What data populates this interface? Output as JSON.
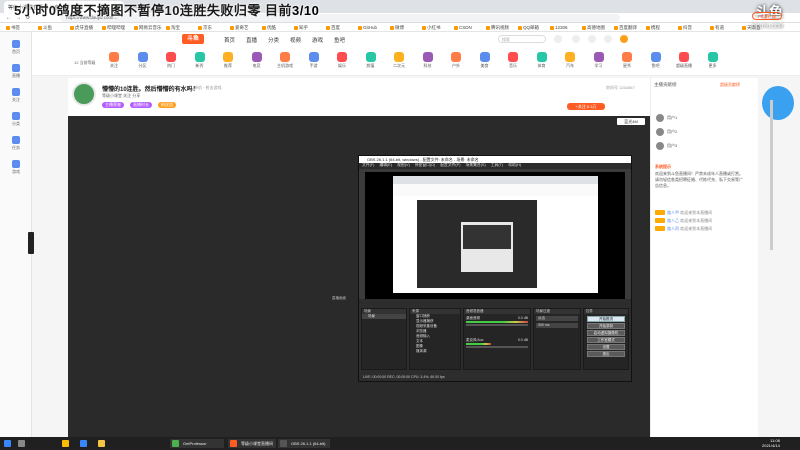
{
  "browser": {
    "tabs": [
      {
        "label": "等级小课堂直播间·斗鱼",
        "active": true
      },
      {
        "label": "……",
        "active": false
      }
    ],
    "url": "https://www.douyu.com/...",
    "bookmarks": [
      "书签",
      "斗鱼",
      "虎牙直播",
      "哔哩哔哩",
      "网易云音乐",
      "淘宝",
      "京东",
      "爱奇艺",
      "优酷",
      "知乎",
      "百度",
      "GitHub",
      "微博",
      "小红书",
      "CSDN",
      "腾讯视频",
      "QQ邮箱",
      "12306",
      "高德地图",
      "百度翻译",
      "携程",
      "抖音",
      "有道",
      "天眼查"
    ]
  },
  "overlay_title": {
    "text": "5小时0鸽度不摘图不暂停10连胜失败归零  目前",
    "progress": "3/10"
  },
  "logo_overlay": {
    "text": "斗鱼",
    "sub": "DOUYU.COM"
  },
  "left_sidebar": [
    {
      "label": "首页",
      "icon": "home-icon"
    },
    {
      "label": "直播",
      "icon": "live-icon"
    },
    {
      "label": "关注",
      "icon": "heart-icon"
    },
    {
      "label": "分类",
      "icon": "grid-icon"
    },
    {
      "label": "任务",
      "icon": "task-icon"
    },
    {
      "label": "游戏",
      "icon": "game-icon"
    }
  ],
  "site_header": {
    "logo": "斗鱼",
    "nav": [
      "首页",
      "直播",
      "分类",
      "视频",
      "游戏",
      "鱼吧"
    ],
    "search_placeholder": "搜索"
  },
  "categories": [
    "关注",
    "分区",
    "热门",
    "新秀",
    "推荐",
    "电竞",
    "主机游戏",
    "手游",
    "娱乐",
    "颜值",
    "二次元",
    "科技",
    "户外",
    "美食",
    "音乐",
    "体育",
    "汽车",
    "学习",
    "星秀",
    "鱼吧",
    "超级直播",
    "更多",
    "PC客户端"
  ],
  "pc_button": "PC客户端",
  "level_box": "12 当前等级",
  "room": {
    "title": "懵懵的10连胜。然后懵懵的有水吗！",
    "category": "单机 · 射击游戏",
    "anchor": "等级小课堂  关注  分享",
    "badges": [
      {
        "label": "主播荣誉",
        "color": "#b35cff"
      },
      {
        "label": "直播时长",
        "color": "#b35cff"
      },
      {
        "label": "粉丝团",
        "color": "#ff9e1b"
      }
    ],
    "follow_label": "+关注 6.3万",
    "room_number": "房间号 1234567"
  },
  "video": {
    "quality_label": "蓝光4M",
    "label": "直播画面",
    "bg": "#2a2a2a"
  },
  "obs": {
    "title": "OBS 26.1.1 (64-bit, windows) - 配置文件: 未命名 - 场景: 未命名",
    "menu": [
      "文件(F)",
      "编辑(E)",
      "视图(V)",
      "停靠窗口(D)",
      "配置文件(P)",
      "场景集合(S)",
      "工具(T)",
      "帮助(H)"
    ],
    "docks": {
      "scenes_title": "场景",
      "scenes": [
        "场景"
      ],
      "sources_title": "来源",
      "sources": [
        "窗口捕获",
        "显示器捕获",
        "视频采集设备",
        "浏览器",
        "音频输入",
        "文本",
        "图像",
        "媒体源"
      ],
      "mixer_title": "音频混音器",
      "mixer": [
        {
          "label": "桌面音频",
          "value": "0.0 dB"
        },
        {
          "label": "麦克风/Aux",
          "value": "0.0 dB"
        }
      ],
      "transitions_title": "场景过渡",
      "transition": "淡出",
      "duration": "300 ms",
      "controls_title": "控件",
      "controls": [
        "开始推流",
        "开始录制",
        "启动虚拟摄像机",
        "工作室模式",
        "设置",
        "退出"
      ]
    },
    "status": "LIVE: 00:00:00   REC: 00:00:00   CPU: 3.4%, 60.00 fps"
  },
  "right_panel": {
    "tabs": "主播贡献榜",
    "menu": "超级贡献榜",
    "ranks": [
      "用户1",
      "用户2",
      "用户3"
    ],
    "notice_head": "系统提示",
    "notice": "欢迎来到斗鱼直播间！严禁未成年人直播或打赏。请勿轻信各类招聘征婚、代练代充、私下交易等广告信息。",
    "chat": [
      {
        "user": "路人甲",
        "text": "欢迎来到本直播间"
      },
      {
        "user": "路人乙",
        "text": "欢迎来到本直播间"
      },
      {
        "user": "路人丙",
        "text": "欢迎来到本直播间"
      }
    ]
  },
  "taskbar": {
    "apps": [
      {
        "label": "Chrome",
        "color": "#fbbc05"
      },
      {
        "label": "OneDrive",
        "color": "#3a86ff"
      },
      {
        "label": "Explorer",
        "color": "#f4c542"
      },
      {
        "label": "GetProfessor",
        "color": "#4caf50"
      },
      {
        "label": "等级小课堂直播间",
        "color": "#ff5d23"
      },
      {
        "label": "OBS 26.1.1 (64-bit)",
        "color": "#555555"
      }
    ],
    "time": "11:08",
    "date": "2021/4/14"
  }
}
